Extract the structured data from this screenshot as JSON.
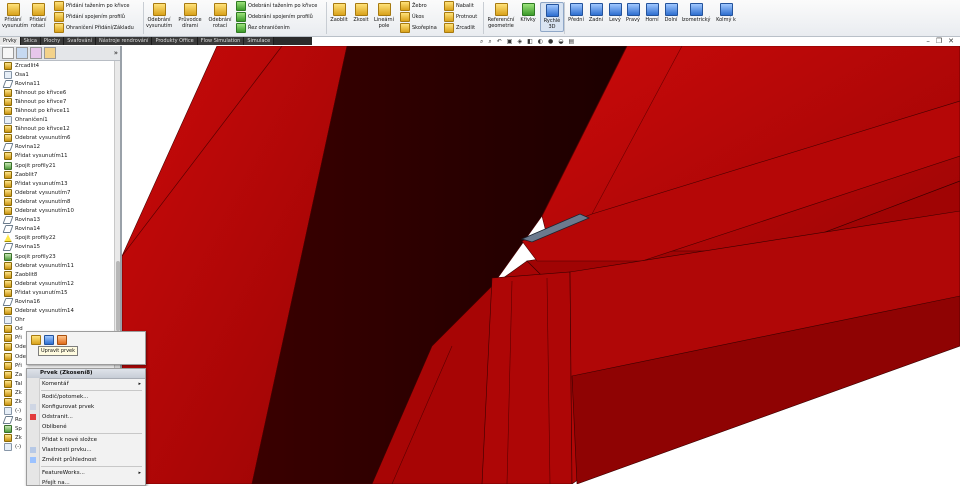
{
  "ribbon": {
    "groups": [
      {
        "label": "Přidání vysunutím"
      },
      {
        "label": "Přidání rotací"
      },
      {
        "label": "Přidání tažením po křivce"
      },
      {
        "label": "Přidání spojením profilů"
      },
      {
        "label": "Ohraničení Přidání/Základu"
      },
      {
        "label": "Odebrání vysunutím"
      },
      {
        "label": "Průvodce dírami"
      },
      {
        "label": "Odebrání rotací"
      },
      {
        "label": "Odebrání tažením po křivce"
      },
      {
        "label": "Odebrání spojením profilů"
      },
      {
        "label": "Řez ohraničením"
      },
      {
        "label": "Zaoblit"
      },
      {
        "label": "Zkosit"
      },
      {
        "label": "Lineární pole"
      },
      {
        "label": "Žebro"
      },
      {
        "label": "Úkos"
      },
      {
        "label": "Skořepina"
      },
      {
        "label": "Nabalit"
      },
      {
        "label": "Protnout"
      },
      {
        "label": "Zrcadlit"
      },
      {
        "label": "Referenční geometrie"
      },
      {
        "label": "Křivky"
      },
      {
        "label": "Rychlé 3D"
      },
      {
        "label": "Přední"
      },
      {
        "label": "Zadní"
      },
      {
        "label": "Levý"
      },
      {
        "label": "Pravý"
      },
      {
        "label": "Horní"
      },
      {
        "label": "Dolní"
      },
      {
        "label": "Izometrický"
      },
      {
        "label": "Kolmý k"
      }
    ]
  },
  "tabs": [
    "Prvky",
    "Skica",
    "Plochy",
    "Svařování",
    "Nástroje rendrování",
    "Produkty Office",
    "Flow Simulation",
    "Simulace"
  ],
  "panel": {
    "more": "»"
  },
  "tree": [
    {
      "label": "Zrcadlit4",
      "icon": "feature"
    },
    {
      "label": "Osa1",
      "icon": "sketch"
    },
    {
      "label": "Rovina11",
      "icon": "plane"
    },
    {
      "label": "Táhnout po křivce6",
      "icon": "feature"
    },
    {
      "label": "Táhnout po křivce7",
      "icon": "feature"
    },
    {
      "label": "Táhnout po křivce11",
      "icon": "feature"
    },
    {
      "label": "Ohraničení1",
      "icon": "sketch"
    },
    {
      "label": "Táhnout po křivce12",
      "icon": "feature"
    },
    {
      "label": "Odebrat vysunutím6",
      "icon": "feature"
    },
    {
      "label": "Rovina12",
      "icon": "plane"
    },
    {
      "label": "Přidat vysunutím11",
      "icon": "feature"
    },
    {
      "label": "Spojit profily21",
      "icon": "loft"
    },
    {
      "label": "Zaoblit7",
      "icon": "feature"
    },
    {
      "label": "Přidat vysunutím13",
      "icon": "feature"
    },
    {
      "label": "Odebrat vysunutím7",
      "icon": "feature"
    },
    {
      "label": "Odebrat vysunutím8",
      "icon": "feature"
    },
    {
      "label": "Odebrat vysunutím10",
      "icon": "feature"
    },
    {
      "label": "Rovina13",
      "icon": "plane"
    },
    {
      "label": "Rovina14",
      "icon": "plane"
    },
    {
      "label": "Spojit profily22",
      "icon": "warn"
    },
    {
      "label": "Rovina15",
      "icon": "plane"
    },
    {
      "label": "Spojit profily23",
      "icon": "loft"
    },
    {
      "label": "Odebrat vysunutím11",
      "icon": "feature"
    },
    {
      "label": "Zaoblit8",
      "icon": "feature"
    },
    {
      "label": "Odebrat vysunutím12",
      "icon": "feature"
    },
    {
      "label": "Přidat vysunutím15",
      "icon": "feature"
    },
    {
      "label": "Rovina16",
      "icon": "plane"
    },
    {
      "label": "Odebrat vysunutím14",
      "icon": "feature"
    },
    {
      "label": "Ohr",
      "icon": "sketch"
    },
    {
      "label": "Od",
      "icon": "feature"
    },
    {
      "label": "Při",
      "icon": "feature"
    },
    {
      "label": "Odebrat vysunutím15",
      "icon": "feature"
    },
    {
      "label": "Odebrat vysunutím16",
      "icon": "feature"
    },
    {
      "label": "Při",
      "icon": "feature"
    },
    {
      "label": "Za",
      "icon": "feature"
    },
    {
      "label": "Tal",
      "icon": "feature"
    },
    {
      "label": "Zk",
      "icon": "feature"
    },
    {
      "label": "Zk",
      "icon": "feature"
    },
    {
      "label": "(-)",
      "icon": "sketch"
    },
    {
      "label": "Ro",
      "icon": "plane"
    },
    {
      "label": "Sp",
      "icon": "loft"
    },
    {
      "label": "Zk",
      "icon": "feature"
    },
    {
      "label": "(-)",
      "icon": "sketch"
    }
  ],
  "context_top": {
    "tooltip": "Upravit prvek"
  },
  "context_menu": {
    "title": "Prvek (Zkosení8)",
    "items": [
      {
        "label": "Komentář",
        "submenu": true
      },
      {
        "label": "Rodič/potomek...",
        "submenu": false
      },
      {
        "label": "Konfigurovat prvek",
        "submenu": false
      },
      {
        "label": "Odstranit...",
        "submenu": false
      },
      {
        "label": "Oblíbené",
        "submenu": false
      },
      {
        "label": "Přidat k nové složce",
        "submenu": false
      },
      {
        "label": "Vlastnosti prvku...",
        "submenu": false
      },
      {
        "label": "Změnit průhlednost",
        "submenu": false
      },
      {
        "label": "FeatureWorks...",
        "submenu": true
      },
      {
        "label": "Přejít na...",
        "submenu": false
      }
    ]
  },
  "model": {
    "fill": "#b80606",
    "dark": "#2b0000",
    "edge": "#4a0000",
    "highlight": "#d01818"
  }
}
